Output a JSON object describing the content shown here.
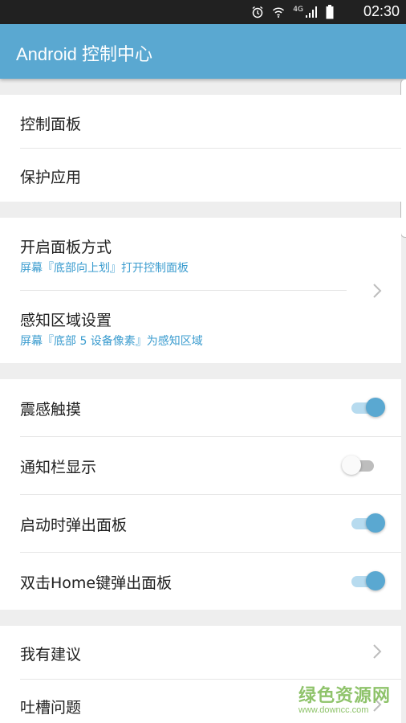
{
  "status_bar": {
    "time": "02:30",
    "network": "4G",
    "icons": [
      "alarm-icon",
      "wifi-icon",
      "signal-icon",
      "battery-icon"
    ]
  },
  "app_bar": {
    "title": "Android 控制中心"
  },
  "section_main": {
    "items": [
      {
        "label": "控制面板"
      },
      {
        "label": "保护应用"
      }
    ]
  },
  "section_panel": {
    "items": [
      {
        "label": "开启面板方式",
        "subtitle": "屏幕『底部向上划』打开控制面板"
      },
      {
        "label": "感知区域设置",
        "subtitle": "屏幕『底部 5 设备像素』为感知区域"
      }
    ]
  },
  "section_toggles": {
    "items": [
      {
        "label": "震感触摸",
        "on": true
      },
      {
        "label": "通知栏显示",
        "on": false
      },
      {
        "label": "启动时弹出面板",
        "on": true
      },
      {
        "label": "双击Home键弹出面板",
        "on": true
      }
    ]
  },
  "section_feedback": {
    "items": [
      {
        "label": "我有建议"
      },
      {
        "label": "吐槽问题"
      }
    ]
  },
  "watermark": {
    "name": "绿色资源网",
    "url": "www.downcc.com"
  },
  "colors": {
    "accent": "#5aa8d1",
    "subtitle": "#3b9ccf",
    "watermark": "#8fc36b"
  }
}
